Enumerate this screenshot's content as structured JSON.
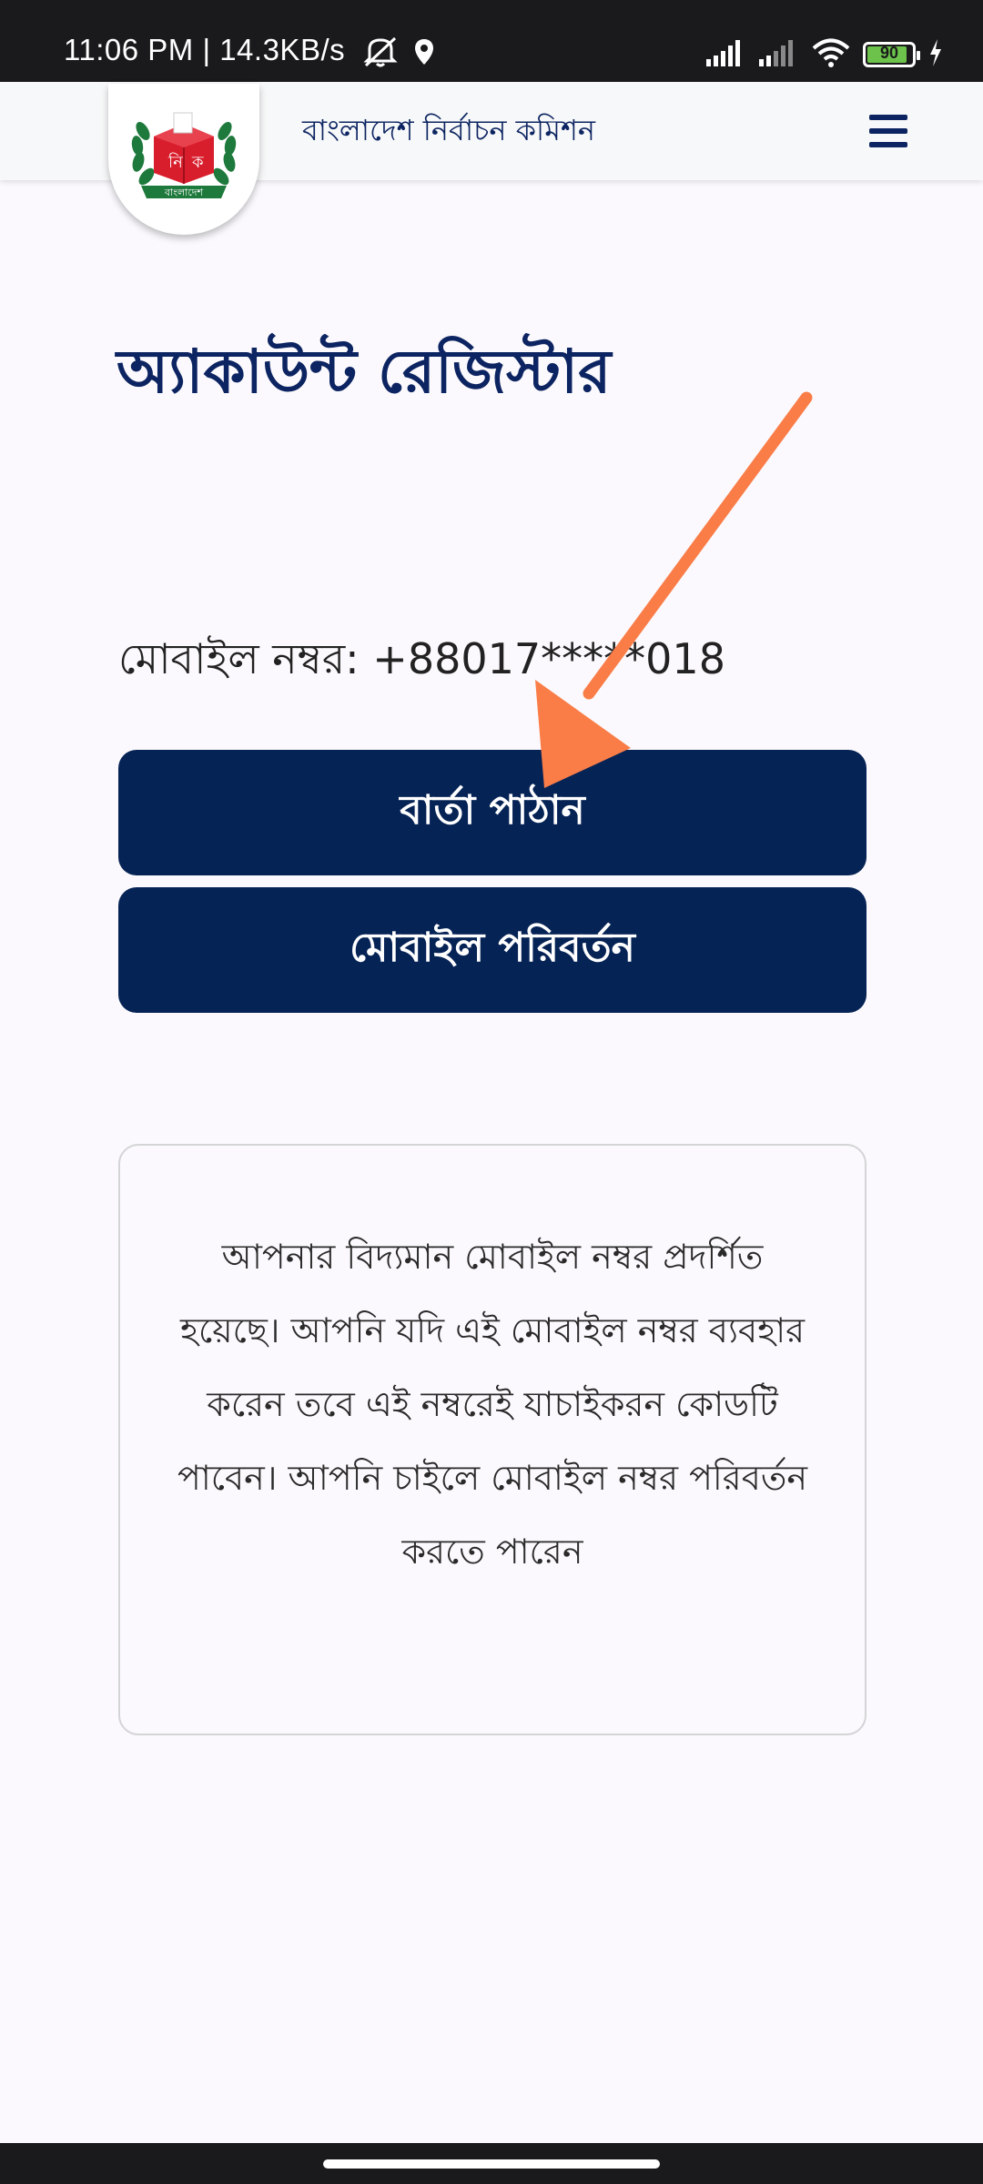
{
  "status_bar": {
    "time_and_speed": "11:06 PM | 14.3KB/s",
    "battery_level": "90",
    "battery_fraction": 0.9,
    "icons": [
      "mute-icon",
      "location-icon",
      "signal-icon",
      "signal-icon",
      "wifi-icon",
      "battery-icon",
      "charging-icon"
    ]
  },
  "header": {
    "title": "বাংলাদেশ নির্বাচন কমিশন",
    "logo_icon": "ec-logo-icon",
    "menu_icon": "hamburger-menu-icon"
  },
  "page": {
    "title": "অ্যাকাউন্ট রেজিস্টার",
    "mobile_label": "মোবাইল নম্বর: +88017*****018",
    "send_button": "বার্তা পাঠান",
    "change_button": "মোবাইল পরিবর্তন",
    "info_text": "আপনার বিদ্যমান মোবাইল নম্বর প্রদর্শিত হয়েছে। আপনি যদি এই মোবাইল নম্বর ব্যবহার করেন তবে এই নম্বরেই যাচাইকরন কোডটি পাবেন। আপনি চাইলে মোবাইল নম্বর পরিবর্তন করতে পারেন"
  },
  "colors": {
    "primary": "#062355",
    "title": "#0c2461",
    "arrow": "#fa7d48",
    "status_bar": "#1a1a1c",
    "battery_green": "#6cc24a",
    "logo_red": "#d81e2c",
    "logo_green": "#1e7a3c"
  }
}
